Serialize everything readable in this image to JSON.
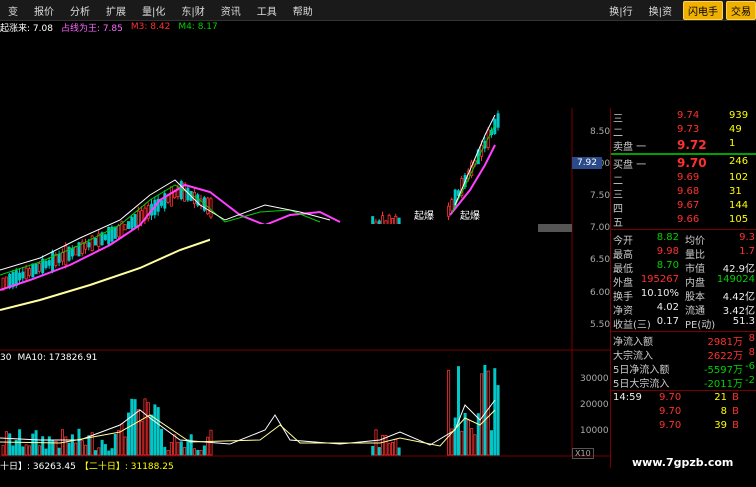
{
  "menu": {
    "items": [
      "变",
      "报价",
      "分析",
      "扩展",
      "量|化",
      "东|财",
      "资讯",
      "工具",
      "帮助"
    ],
    "right_items": [
      "换|行",
      "换|资"
    ],
    "flash_button": "闪电手",
    "trade_button": "交易"
  },
  "legend": {
    "items": [
      {
        "text": "起涨来: 7.08",
        "color": "#ffffff"
      },
      {
        "text": "占线为王: 7.85",
        "color": "#ff66ff"
      },
      {
        "text": "M3: 8.42",
        "color": "#ff3030"
      },
      {
        "text": "M4: 8.17",
        "color": "#00d000"
      }
    ]
  },
  "price_axis": {
    "labels": [
      "8.50",
      "8.00",
      "7.50",
      "7.00",
      "6.50",
      "6.00",
      "5.50"
    ],
    "current_marker": "7.92"
  },
  "volume_axis": {
    "labels": [
      "30000",
      "20000",
      "10000"
    ],
    "scale_button": "X10"
  },
  "annotations": [
    "起爆",
    "起爆"
  ],
  "volume_legend": {
    "items": [
      {
        "text": "30",
        "color": "#ffffff"
      },
      {
        "text": "MA10: 173826.91",
        "color": "#ffffff"
      }
    ]
  },
  "bottom_legend": {
    "items": [
      {
        "text": "十日】: 36263.45",
        "color": "#ffffff"
      },
      {
        "text": "【二十日】: 31188.25",
        "color": "#ffff00"
      }
    ]
  },
  "order_book": {
    "sell": [
      {
        "label": "三",
        "price": "9.74",
        "vol": "939"
      },
      {
        "label": "二",
        "price": "9.73",
        "vol": "49"
      },
      {
        "label": "卖盘 一",
        "price": "9.72",
        "vol": "1"
      }
    ],
    "buy": [
      {
        "label": "买盘 一",
        "price": "9.70",
        "vol": "246"
      },
      {
        "label": "二",
        "price": "9.69",
        "vol": "102"
      },
      {
        "label": "三",
        "price": "9.68",
        "vol": "31"
      },
      {
        "label": "四",
        "price": "9.67",
        "vol": "144"
      },
      {
        "label": "五",
        "price": "9.66",
        "vol": "105"
      }
    ]
  },
  "stats": [
    {
      "l1": "今开",
      "v1": "8.82",
      "c1": "green",
      "l2": "均价",
      "v2": "9.3",
      "c2": "red"
    },
    {
      "l1": "最高",
      "v1": "9.98",
      "c1": "red",
      "l2": "量比",
      "v2": "1.7",
      "c2": "red"
    },
    {
      "l1": "最低",
      "v1": "8.70",
      "c1": "green",
      "l2": "市值",
      "v2": "42.9亿",
      "c2": "white"
    },
    {
      "l1": "外盘",
      "v1": "195267",
      "c1": "red",
      "l2": "内盘",
      "v2": "149024",
      "c2": "green"
    },
    {
      "l1": "换手",
      "v1": "10.10%",
      "c1": "white",
      "l2": "股本",
      "v2": "4.42亿",
      "c2": "white"
    },
    {
      "l1": "净资",
      "v1": "4.02",
      "c1": "white",
      "l2": "流通",
      "v2": "3.42亿",
      "c2": "white"
    },
    {
      "l1": "收益(三)",
      "v1": "0.17",
      "c1": "white",
      "l2": "PE(动)",
      "v2": "51.3",
      "c2": "white"
    }
  ],
  "flows": [
    {
      "label": "净流入额",
      "value": "2981万",
      "color": "red",
      "pct": "8"
    },
    {
      "label": "大宗流入",
      "value": "2622万",
      "color": "red",
      "pct": "8"
    },
    {
      "label": "5日净流入额",
      "value": "-5597万",
      "color": "green",
      "pct": "-6"
    },
    {
      "label": "5日大宗流入",
      "value": "-2011万",
      "color": "green",
      "pct": "-2"
    }
  ],
  "ticks": [
    {
      "time": "14:59",
      "price": "9.70",
      "vol": "21",
      "side": "B"
    },
    {
      "time": "",
      "price": "9.70",
      "vol": "8",
      "side": "B"
    },
    {
      "time": "",
      "price": "9.70",
      "vol": "39",
      "side": "B"
    }
  ],
  "watermark": "www.7gpzb.com"
}
